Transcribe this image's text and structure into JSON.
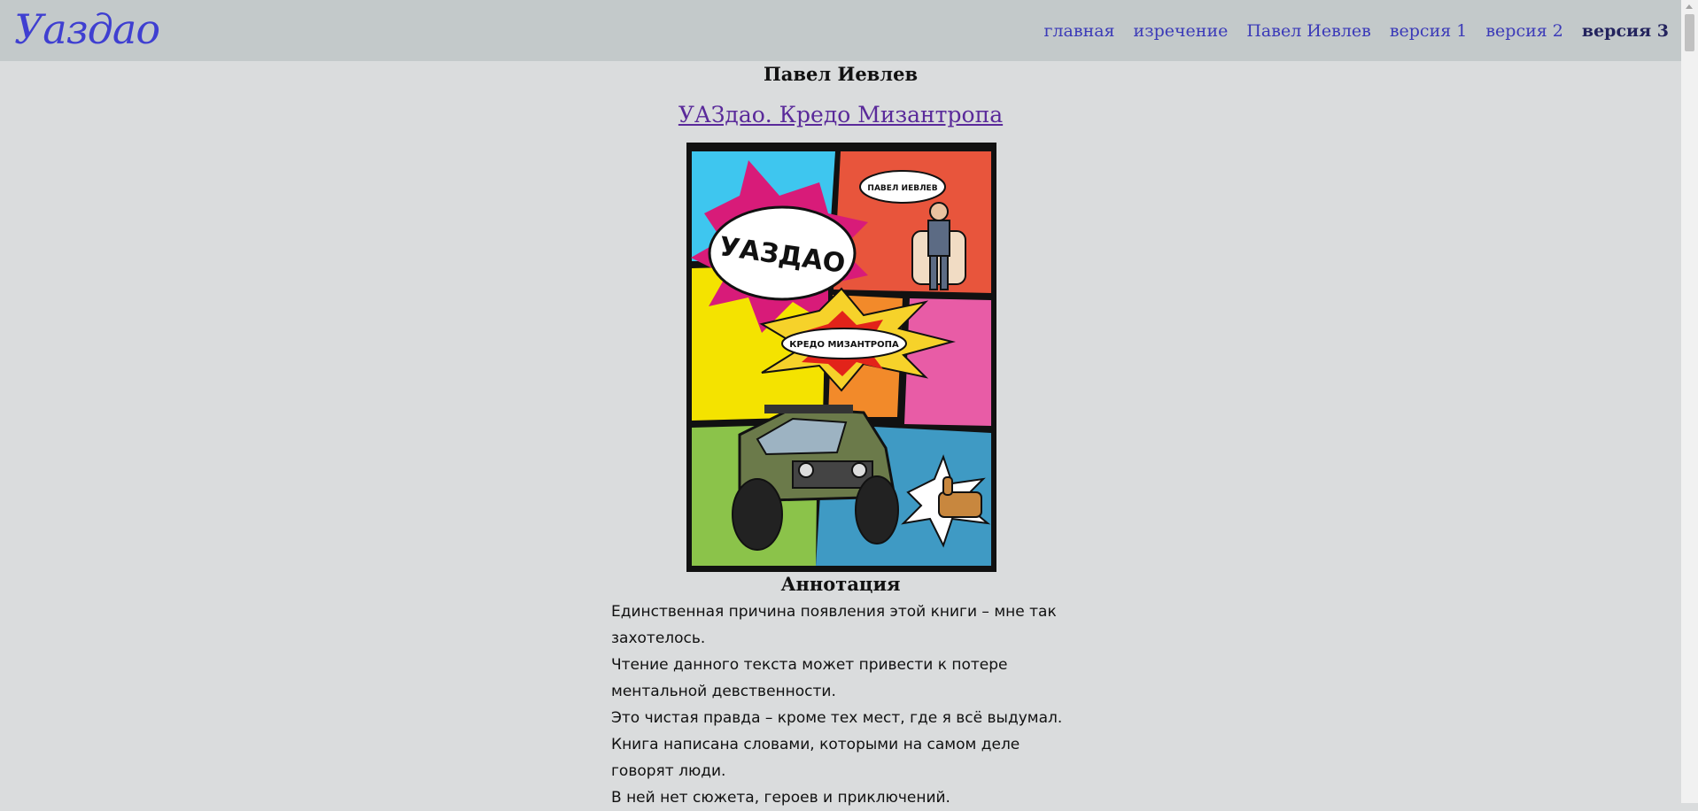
{
  "header": {
    "logo_text": "Уаздао",
    "nav": [
      {
        "label": "главная"
      },
      {
        "label": "изречение"
      },
      {
        "label": "Павел Иевлев"
      },
      {
        "label": "версия 1"
      },
      {
        "label": "версия 2"
      },
      {
        "label": "версия 3",
        "active": true
      }
    ]
  },
  "main": {
    "author": "Павел Иевлев",
    "book_title": "УАЗдао. Кредо Мизантропа",
    "cover": {
      "author_bubble": "ПАВЕЛ ИЕВЛЕВ",
      "title_bubble": "УАЗДАО",
      "subtitle_bubble": "КРЕДО МИЗАНТРОПА"
    },
    "annotation_heading": "Аннотация",
    "annotation": [
      "Единственная причина появления этой книги – мне так захотелось.",
      "Чтение данного текста может привести к потере ментальной девственности.",
      "Это чистая правда – кроме тех мест, где я всё выдумал.",
      "Книга написана словами, которыми на самом деле говорят люди.",
      "В ней нет сюжета, героев и приключений."
    ]
  },
  "colors": {
    "page_bg": "#dadcdd",
    "header_bg": "#c3c9ca",
    "nav_link": "#3b3ab8",
    "title_link": "#5a2a9a"
  }
}
